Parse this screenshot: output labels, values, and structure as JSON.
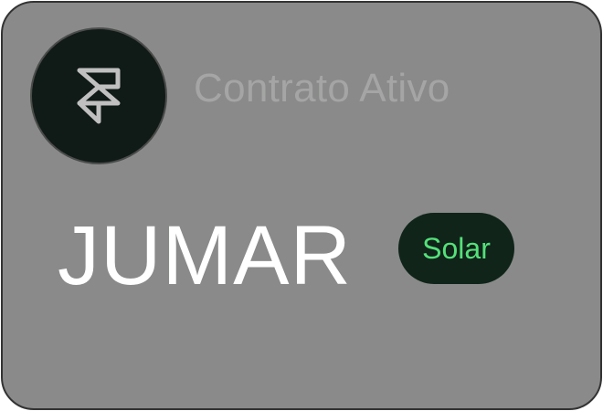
{
  "card": {
    "logo_icon": "framer-logo-icon",
    "status": "Contrato Ativo",
    "client_name": "JUMAR",
    "badge": {
      "label": "Solar",
      "text_color": "#55e07a",
      "background_color": "#10241a"
    },
    "background_color": "#898a89"
  }
}
